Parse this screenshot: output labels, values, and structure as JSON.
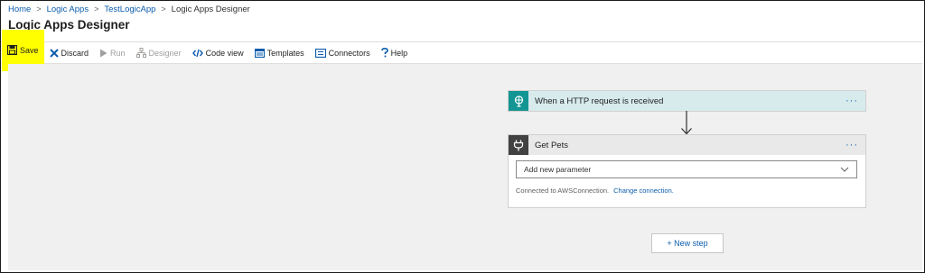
{
  "breadcrumb": {
    "items": [
      "Home",
      "Logic Apps",
      "TestLogicApp",
      "Logic Apps Designer"
    ],
    "separator": ">"
  },
  "page_title": "Logic Apps Designer",
  "toolbar": {
    "save": "Save",
    "discard": "Discard",
    "run": "Run",
    "designer": "Designer",
    "code_view": "Code view",
    "templates": "Templates",
    "connectors": "Connectors",
    "help": "Help"
  },
  "canvas": {
    "trigger": {
      "title": "When a HTTP request is received",
      "more": "···",
      "icon": "http-request-icon",
      "color": "#139594"
    },
    "action": {
      "title": "Get Pets",
      "more": "···",
      "icon": "plug-icon",
      "color": "#414141",
      "parameter_placeholder": "Add new parameter",
      "connection_text": "Connected to AWSConnection.",
      "change_connection": "Change connection."
    },
    "new_step": "+ New step"
  },
  "colors": {
    "highlight": "#ffff00",
    "link": "#0b5cad",
    "canvas_bg": "#f0f0f0"
  }
}
